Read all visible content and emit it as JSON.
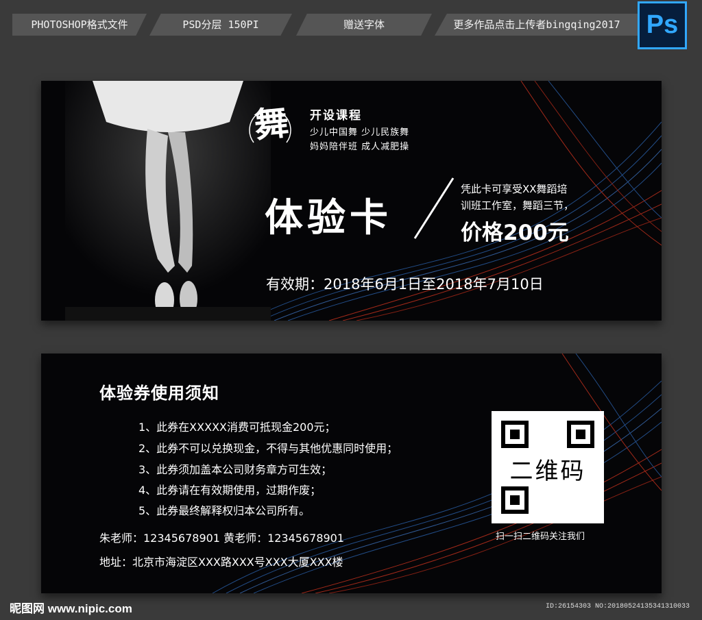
{
  "topbar": {
    "tabs": [
      {
        "label": "PHOTOSHOP格式文件"
      },
      {
        "label": "PSD分层 150PI"
      },
      {
        "label": "赠送字体"
      },
      {
        "label": "更多作品点击上传者bingqing2017"
      }
    ],
    "ps_badge": "Ps"
  },
  "card_front": {
    "logo_char": "舞",
    "course_title": "开设课程",
    "course_lines": [
      "少儿中国舞 少儿民族舞",
      "妈妈陪伴班 成人减肥操"
    ],
    "heading": "体验卡",
    "desc_lines": [
      "凭此卡可享受XX舞蹈培",
      "训班工作室，舞蹈三节，"
    ],
    "price": "价格200元",
    "validity": "有效期：2018年6月1日至2018年7月10日"
  },
  "card_back": {
    "notice_title": "体验券使用须知",
    "rules": [
      "1、此券在XXXXX消费可抵现金200元；",
      "2、此券不可以兑换现金，不得与其他优惠同时使用；",
      "3、此券须加盖本公司财务章方可生效；",
      "4、此券请在有效期使用，过期作废；",
      "5、此券最终解释权归本公司所有。"
    ],
    "phones": "朱老师：12345678901  黄老师：12345678901",
    "address": "地址：北京市海淀区XXX路XXX号XXX大厦XXX楼",
    "qr_label": "二维码",
    "qr_caption": "扫一扫二维码关注我们"
  },
  "footer": {
    "site": "昵图网 www.nipic.com",
    "id_text": "ID:26154303 NO:20180524135341310033"
  },
  "colors": {
    "background": "#3a3a3a",
    "card": "#050507",
    "wave_red": "#c8321e",
    "wave_blue": "#2a5fa8",
    "ps_blue": "#31a8ff"
  },
  "icons": [
    "ps-logo-icon",
    "dance-logo-icon",
    "qr-code-icon",
    "ballerina-image"
  ]
}
